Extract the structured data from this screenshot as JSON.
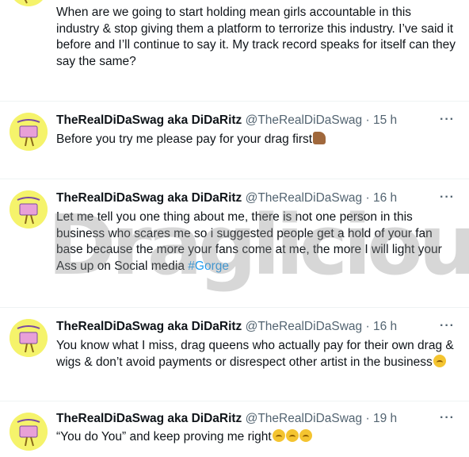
{
  "watermark": "Draglicious",
  "tweets": [
    {
      "text": "When are we going to start holding mean girls accountable in this industry & stop giving them a platform to terrorize this industry. I’ve said it before and I’ll continue to say it. My track record speaks for itself can they say the same?"
    },
    {
      "name": "TheRealDiDaSwag aka DiDaRitz",
      "handle": "@TheRealDiDaSwag",
      "separator": "·",
      "time": "15 h",
      "text": "Before you try me please pay for your drag first",
      "emoji": "thumbs-up-emoji"
    },
    {
      "name": "TheRealDiDaSwag aka DiDaRitz",
      "handle": "@TheRealDiDaSwag",
      "separator": "·",
      "time": "16 h",
      "text": "Let me tell you one thing about me, there is not one person in this business who scares me so i suggested people get a hold of your fan base because the more your fans come at me, the more I will light your Ass up on Social media",
      "hashtag": "#Gorge"
    },
    {
      "name": "TheRealDiDaSwag aka DiDaRitz",
      "handle": "@TheRealDiDaSwag",
      "separator": "·",
      "time": "16 h",
      "text": "You know what I miss, drag queens who actually pay for their own drag & wigs & don’t avoid payments or disrespect other artist in the business",
      "emoji": "upside-down-face-emoji"
    },
    {
      "name": "TheRealDiDaSwag aka DiDaRitz",
      "handle": "@TheRealDiDaSwag",
      "separator": "·",
      "time": "19 h",
      "text": "“You do You” and keep proving me right",
      "emoji": "upside-down-face-emoji"
    }
  ],
  "more_label": "···",
  "colors": {
    "accent": "#1d9bf0",
    "secondary_text": "#536471",
    "avatar_bg": "#f5f36b"
  }
}
